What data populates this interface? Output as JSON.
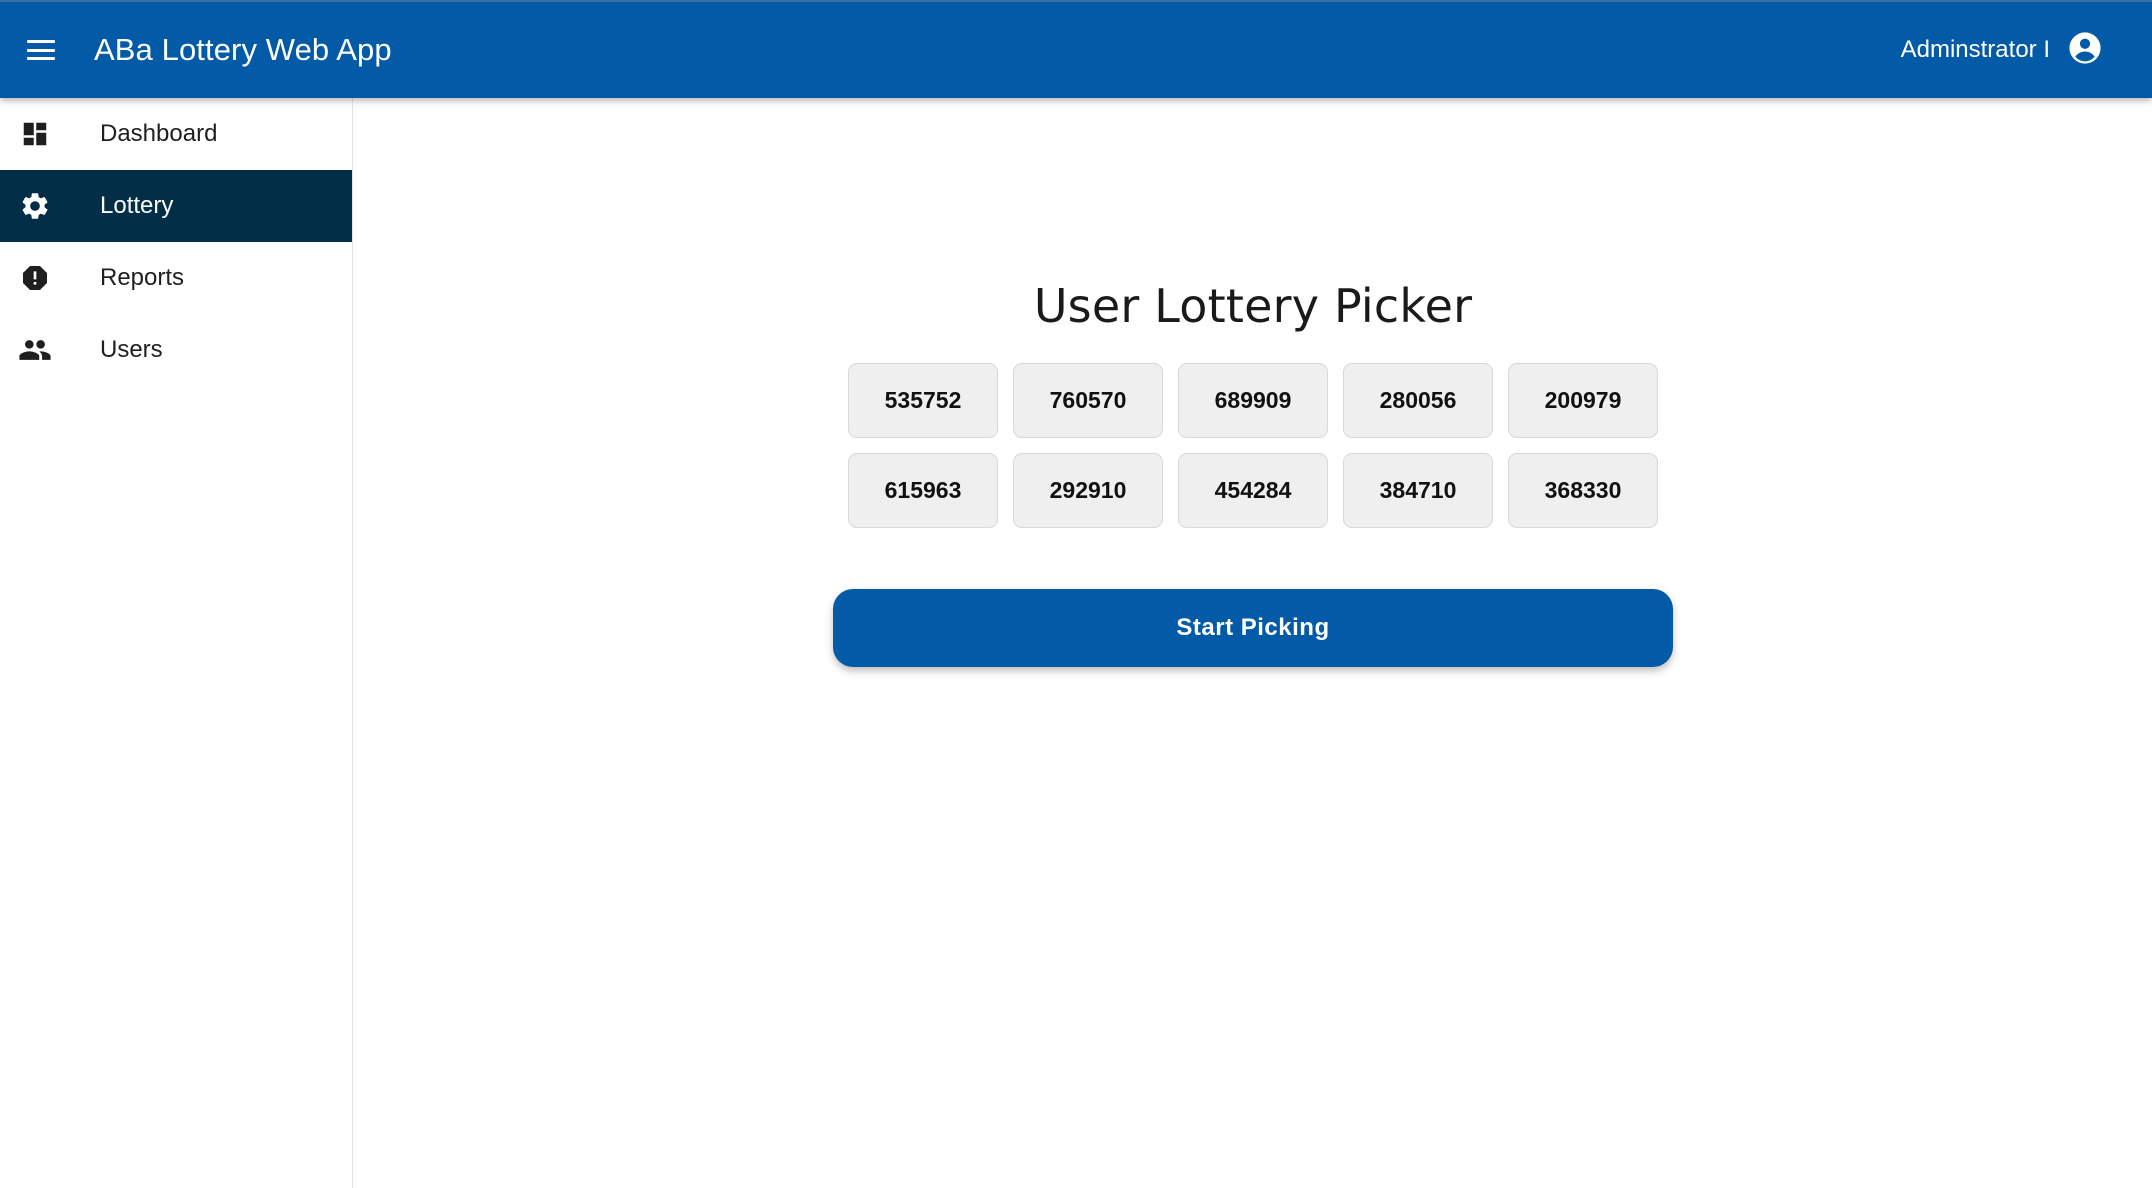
{
  "header": {
    "app_title": "ABa Lottery Web App",
    "user_name": "Adminstrator I",
    "menu_icon": "hamburger-menu-icon",
    "account_icon": "account-circle-icon"
  },
  "sidebar": {
    "items": [
      {
        "label": "Dashboard",
        "icon": "dashboard-icon",
        "active": false
      },
      {
        "label": "Lottery",
        "icon": "gear-icon",
        "active": true
      },
      {
        "label": "Reports",
        "icon": "alert-octagon-icon",
        "active": false
      },
      {
        "label": "Users",
        "icon": "people-icon",
        "active": false
      }
    ]
  },
  "main": {
    "title": "User Lottery Picker",
    "numbers": [
      "535752",
      "760570",
      "689909",
      "280056",
      "200979",
      "615963",
      "292910",
      "454284",
      "384710",
      "368330"
    ],
    "start_button_label": "Start Picking"
  },
  "colors": {
    "appbar": "#035aa6",
    "active_nav": "#032e47",
    "number_button_bg": "#efefef",
    "start_button": "#035aa6"
  }
}
